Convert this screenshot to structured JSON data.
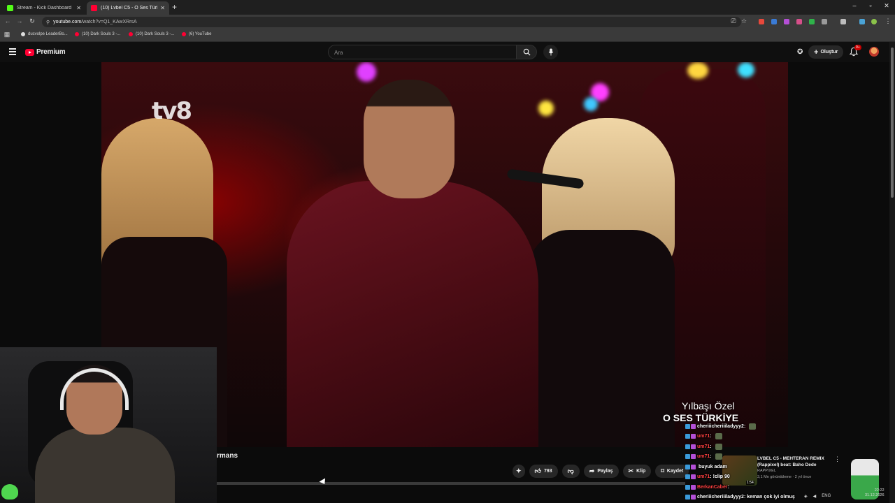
{
  "browser": {
    "tabs": [
      {
        "label": "Stream - Kick Dashboard",
        "favicon_color": "#53fc18",
        "active": false
      },
      {
        "label": "(10) Lvbel C5 - O Ses Türkiy...",
        "favicon_color": "#ff0033",
        "active": true
      }
    ],
    "new_tab": "+",
    "window_controls": [
      "–",
      "▫",
      "✕"
    ],
    "url_host": "youtube.com",
    "url_path": "/watch?v=Q1_KAwXRrsA",
    "bookmarks": [
      {
        "label": "ducvolpe LeaderBo...",
        "favicon_color": "#dddddd"
      },
      {
        "label": "(10) Dark Souls 3 -...",
        "favicon_color": "#ff0033"
      },
      {
        "label": "(10) Dark Souls 3 -...",
        "favicon_color": "#ff0033"
      },
      {
        "label": "(6) YouTube",
        "favicon_color": "#ff0033"
      }
    ]
  },
  "masthead": {
    "brand": "Premium",
    "search_placeholder": "Ara",
    "create_label": "Oluştur",
    "notification_badge": "9+"
  },
  "video": {
    "channel_bug": "tv8",
    "caption_line1": "Yılbaşı Özel",
    "caption_line2": "O SES TÜRKİYE",
    "title_fragment": "rmans"
  },
  "actions": {
    "like_count": "793",
    "share_label": "Paylaş",
    "clip_label": "Klip",
    "save_label": "Kaydet"
  },
  "related": {
    "title": "LVBEL C5 - MEHTERAN REMIX (Rappixel) beat: Baho Dede",
    "channel": "RAPPIXEL",
    "meta": "3,1 Mn görüntüleme · 2 yıl önce",
    "duration": "1:54"
  },
  "chat": [
    {
      "user": "cheriiicheriiiladyyy2",
      "color": "#ffffff",
      "message": "",
      "emote": true
    },
    {
      "user": "um71",
      "color": "#ff4040",
      "message": "",
      "emote": true
    },
    {
      "user": "um71",
      "color": "#ff4040",
      "message": "",
      "emote": true
    },
    {
      "user": "um71",
      "color": "#ff4040",
      "message": "",
      "emote": true
    },
    {
      "user": "",
      "color": "#ffffff",
      "message": "buyuk adam",
      "emote": false
    },
    {
      "user": "um71",
      "color": "#ff4040",
      "message": "!clip 90",
      "emote": false
    },
    {
      "user": "BerkanCaber",
      "color": "#ff4040",
      "message": "",
      "emote": false
    },
    {
      "user": "cheriiicheriiiladyyy2",
      "color": "#ffffff",
      "message": "keman çok iyi olmuş",
      "emote": false
    }
  ],
  "tray": {
    "lang": "ENG",
    "time": "22:22",
    "date": "31.12.2026"
  }
}
